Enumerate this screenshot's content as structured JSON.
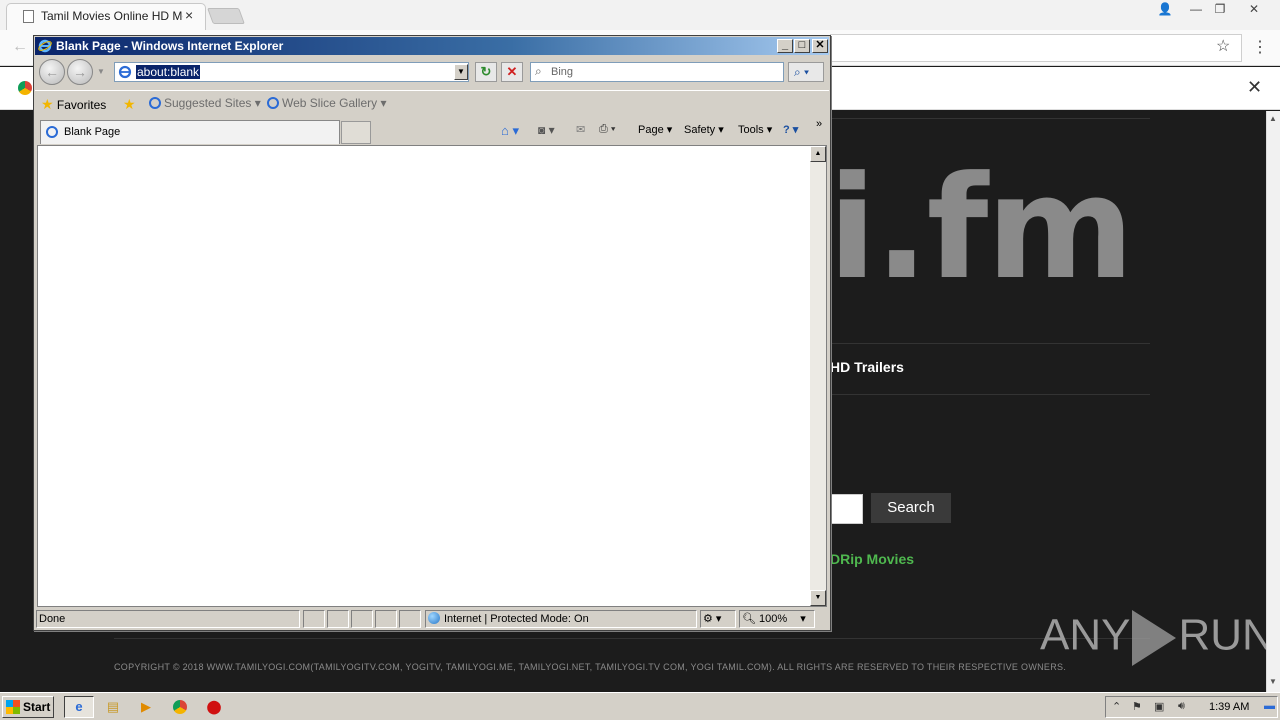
{
  "chrome": {
    "tab_title": "Tamil Movies Online HD Mov",
    "tab_close": "×",
    "window_controls": {
      "user": "👤",
      "minimize": "—",
      "restore": "❐",
      "close": "✕"
    }
  },
  "site": {
    "logo_text": "i.fm",
    "nav_item": "HD Trailers",
    "search_button": "Search",
    "rip_movies": "DRip Movies",
    "copyright": "COPYRIGHT © 2018 WWW.TAMILYOGI.COM(TAMILYOGITV.COM, YOGITV, TAMILYOGI.ME, TAMILYOGI.NET, TAMILYOGI.TV COM, YOGI TAMIL.COM). ALL RIGHTS ARE RESERVED TO THEIR RESPECTIVE OWNERS.",
    "watermark_left": "ANY",
    "watermark_right": "RUN"
  },
  "ie": {
    "window_title": "Blank Page - Windows Internet Explorer",
    "address": "about:blank",
    "search_placeholder": "Bing",
    "favorites_label": "Favorites",
    "suggested_sites": "Suggested Sites",
    "web_slice_gallery": "Web Slice Gallery",
    "tab_label": "Blank Page",
    "cmd": {
      "page": "Page",
      "safety": "Safety",
      "tools": "Tools"
    },
    "status": {
      "done": "Done",
      "zone": "Internet | Protected Mode: On",
      "zoom": "100%"
    }
  },
  "taskbar": {
    "start": "Start",
    "clock": "1:39 AM"
  }
}
